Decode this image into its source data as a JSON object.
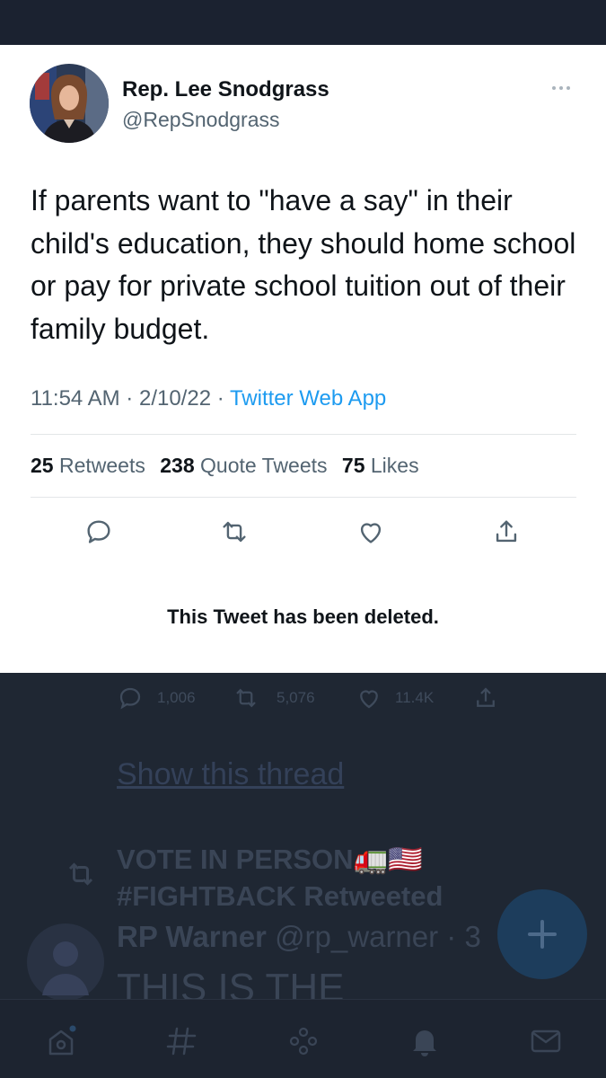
{
  "tweet": {
    "author_name": "Rep. Lee Snodgrass",
    "author_handle": "@RepSnodgrass",
    "text": "If parents want to \"have a say\" in their child's education, they should home school or pay for private school tuition out of their family budget.",
    "time": "11:54 AM",
    "date": "2/10/22",
    "source": "Twitter Web App",
    "retweets_count": "25",
    "retweets_label": "Retweets",
    "quote_count": "238",
    "quote_label": "Quote Tweets",
    "likes_count": "75",
    "likes_label": "Likes",
    "deleted_notice": "This Tweet has been deleted."
  },
  "background": {
    "reply_count": "1,006",
    "retweet_count": "5,076",
    "like_count": "11.4K",
    "show_thread": "Show this thread",
    "retweeted_by_line1": "VOTE IN PERSON🚛🇺🇸",
    "retweeted_by_line2": "#FIGHTBACK Retweeted",
    "next_author": "RP Warner",
    "next_handle": "@rp_warner · 3",
    "next_text": "THIS IS THE"
  },
  "icons": [
    "more-icon",
    "reply-icon",
    "retweet-icon",
    "like-icon",
    "share-icon",
    "home-icon",
    "explore-icon",
    "spaces-icon",
    "notifications-icon",
    "messages-icon",
    "compose-icon"
  ],
  "colors": {
    "accent": "#1d9bf0",
    "overlay": "#1f2733",
    "text": "#0f1419",
    "muted": "#536471"
  }
}
